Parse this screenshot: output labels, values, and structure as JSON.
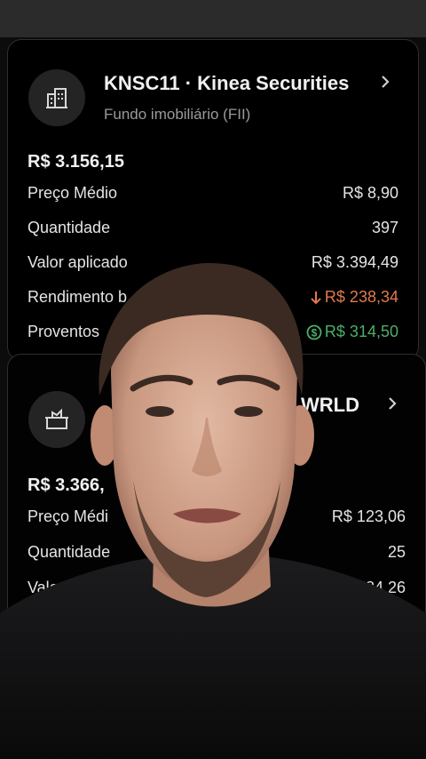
{
  "holdings": [
    {
      "icon": "building-icon",
      "title": "KNSC11 · Kinea Securities",
      "subtitle": "Fundo imobiliário (FII)",
      "total": "R$ 3.156,15",
      "rows": [
        {
          "label": "Preço Médio",
          "value": "R$ 8,90"
        },
        {
          "label": "Quantidade",
          "value": "397"
        },
        {
          "label": "Valor aplicado",
          "value": "R$ 3.394,49"
        },
        {
          "label": "Rendimento b",
          "value": "R$ 238,34",
          "trend": "down"
        },
        {
          "label": "Proventos",
          "value": "R$ 314,50",
          "trend": "dividend"
        }
      ]
    },
    {
      "icon": "basket-icon",
      "title": "WRLD",
      "total": "R$ 3.366,",
      "rows": [
        {
          "label": "Preço Médi",
          "value": "R$ 123,06"
        },
        {
          "label": "Quantidade",
          "value": "25"
        },
        {
          "label": "Valor",
          "value": "584,26"
        }
      ]
    }
  ],
  "colors": {
    "negative": "#e07a4c",
    "positive": "#4caf6a",
    "card_bg": "#000000"
  }
}
